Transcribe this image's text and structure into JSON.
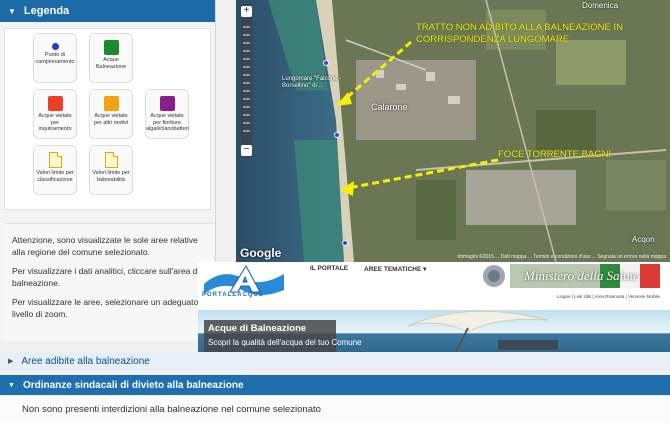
{
  "legend": {
    "title": "Legenda",
    "items": [
      {
        "label": "Punto di campionamento",
        "color": "#1d3ec8",
        "symbol": "dot-icon"
      },
      {
        "label": "Acque Balneazione",
        "color": "#1e8a2e",
        "symbol": "square-icon"
      },
      {
        "label": "Acque vietate per inquinamento",
        "color": "#e8402a",
        "symbol": "square-icon"
      },
      {
        "label": "Acque vietate per altri motivi",
        "color": "#f5a212",
        "symbol": "square-icon"
      },
      {
        "label": "Acque vietate per fioriture algali/cianobatteri",
        "color": "#8a1e8e",
        "symbol": "square-icon"
      },
      {
        "label": "Valori limite per classificazione",
        "color": "#e9a700",
        "symbol": "document-icon"
      },
      {
        "label": "Valori limite per balneabilità",
        "color": "#e9a700",
        "symbol": "document-icon"
      }
    ]
  },
  "info": {
    "p1": "Attenzione, sono visualizzate le sole aree relative alla regione del comune selezionato.",
    "p2": "Per visualizzare i dati analitici, cliccare sull'area di balneazione.",
    "p3": "Per visualizzare le aree, selezionare un adeguato livello di zoom."
  },
  "map": {
    "annotation1": "TRATTO NON ADIBITO ALLA BALNEAZIONE IN CORRISPONDENZA LUNGOMARE",
    "annotation2": "FOCE TORRENTE BAGNI",
    "place_lungomare": "Lungomare \"Falcone - Borsellino\" di ...",
    "place_town": "Calarone",
    "place_top": "Domenica",
    "place_right": "Acqon",
    "google": "Google",
    "attribution": "Immagini ©2015 ... Dati mappa ... Termini e condizioni d'uso ... Segnala un errore nella mappa",
    "annotation_color": "#f5f000"
  },
  "portal": {
    "logo_text": "PORTALEACQUE",
    "nav": [
      "IL PORTALE",
      "AREE TEMATICHE ▾"
    ],
    "ministry": "Ministero della Salute",
    "subnav": "Lingue | Link Utili | Area Riservata | Versione Mobile",
    "hero_title": "Acque di Balneazione",
    "hero_subtitle": "Scopri la qualità dell'acqua del tuo Comune"
  },
  "accordion": {
    "aree_label": "Aree adibite alla balneazione",
    "ordinanze_label": "Ordinanze sindacali di divieto alla balneazione",
    "ordinanze_body": "Non sono presenti interdizioni alla balneazione nel comune selezionato"
  }
}
